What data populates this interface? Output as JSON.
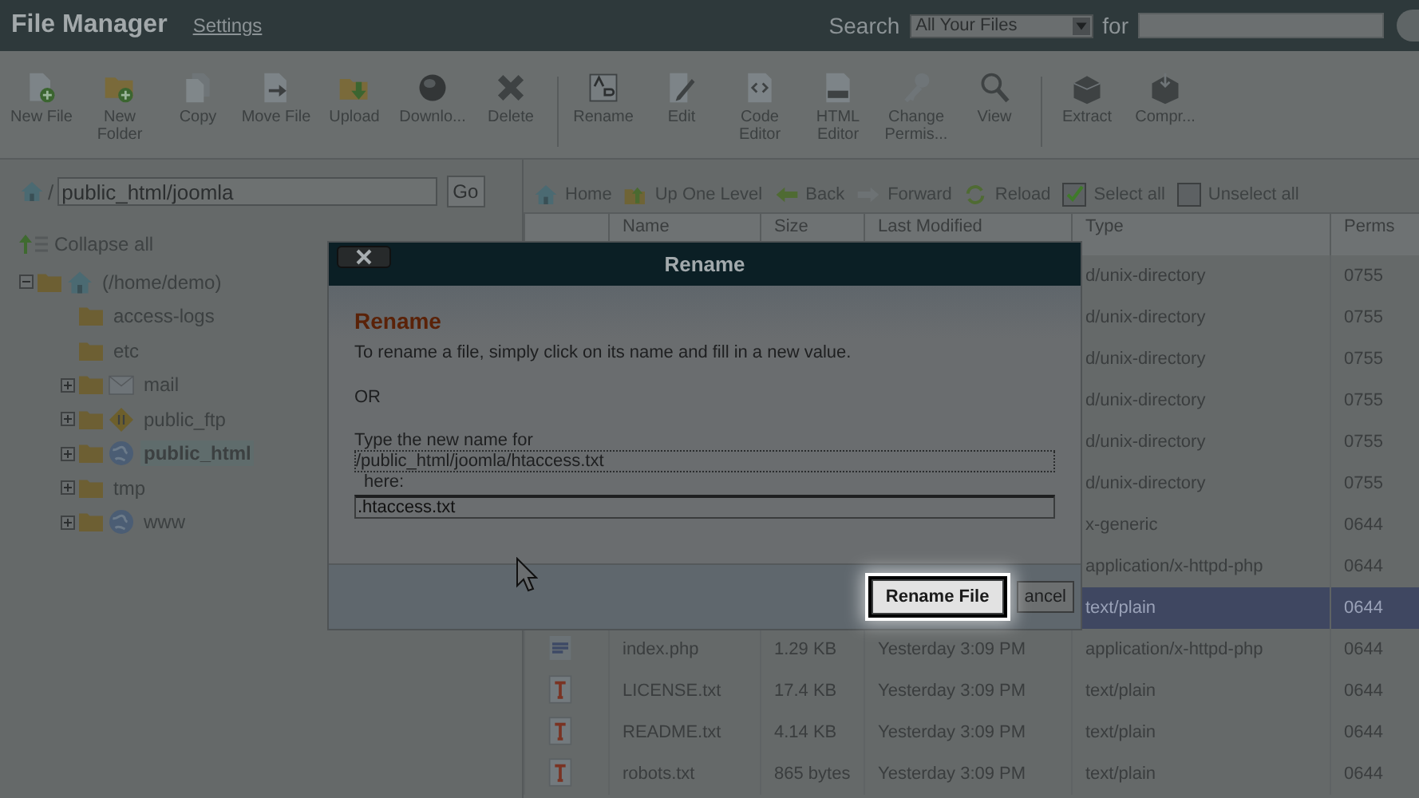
{
  "header": {
    "title": "File Manager",
    "settings_link": "Settings",
    "search_label": "Search",
    "search_scope": "All Your Files",
    "for_label": "for"
  },
  "toolbar": {
    "groups": [
      [
        {
          "label": "New File"
        },
        {
          "label": "New Folder"
        },
        {
          "label": "Copy"
        },
        {
          "label": "Move File"
        },
        {
          "label": "Upload"
        },
        {
          "label": "Downlo..."
        },
        {
          "label": "Delete"
        }
      ],
      [
        {
          "label": "Rename"
        },
        {
          "label": "Edit"
        },
        {
          "label": "Code Editor"
        },
        {
          "label": "HTML Editor"
        },
        {
          "label": "Change Permis..."
        },
        {
          "label": "View"
        }
      ],
      [
        {
          "label": "Extract"
        },
        {
          "label": "Compr..."
        }
      ]
    ]
  },
  "path_bar": {
    "separator": "/",
    "value": "public_html/joomla",
    "button": "Go"
  },
  "tree": {
    "collapse_all": "Collapse all",
    "items": [
      {
        "label": "(/home/demo)",
        "kind": "home",
        "expanded": true,
        "selected": false,
        "children": [
          {
            "label": "access-logs",
            "kind": "folder",
            "selected": false
          },
          {
            "label": "etc",
            "kind": "folder",
            "selected": false
          },
          {
            "label": "mail",
            "kind": "mail",
            "expanded": false,
            "selected": false
          },
          {
            "label": "public_ftp",
            "kind": "ftp",
            "expanded": false,
            "selected": false
          },
          {
            "label": "public_html",
            "kind": "web",
            "expanded": false,
            "selected": true
          },
          {
            "label": "tmp",
            "kind": "folder",
            "expanded": false,
            "selected": false
          },
          {
            "label": "www",
            "kind": "web",
            "expanded": false,
            "selected": false
          }
        ]
      }
    ]
  },
  "nav": [
    {
      "kind": "link",
      "label": "Home"
    },
    {
      "kind": "link",
      "label": "Up One Level"
    },
    {
      "kind": "link",
      "label": "Back"
    },
    {
      "kind": "link",
      "label": "Forward"
    },
    {
      "kind": "link",
      "label": "Reload"
    },
    {
      "kind": "checkbox",
      "label": "Select all",
      "checked": true
    },
    {
      "kind": "checkbox",
      "label": "Unselect all",
      "checked": false
    }
  ],
  "table": {
    "columns": [
      "Name",
      "Size",
      "Last Modified",
      "Type",
      "Perms"
    ],
    "rows": [
      {
        "type": "d/unix-directory",
        "perms": "0755",
        "selected": false
      },
      {
        "type": "d/unix-directory",
        "perms": "0755",
        "selected": false
      },
      {
        "type": "d/unix-directory",
        "perms": "0755",
        "selected": false
      },
      {
        "type": "d/unix-directory",
        "perms": "0755",
        "selected": false
      },
      {
        "type": "d/unix-directory",
        "perms": "0755",
        "selected": false
      },
      {
        "type": "d/unix-directory",
        "perms": "0755",
        "selected": false
      },
      {
        "type": "x-generic",
        "perms": "0644",
        "selected": false
      },
      {
        "type": "application/x-httpd-php",
        "perms": "0644",
        "selected": false
      },
      {
        "type": "text/plain",
        "perms": "0644",
        "selected": true
      },
      {
        "kind": "php",
        "name": "index.php",
        "size": "1.29 KB",
        "modified": "Yesterday 3:09 PM",
        "type": "application/x-httpd-php",
        "perms": "0644",
        "selected": false
      },
      {
        "kind": "text",
        "name": "LICENSE.txt",
        "size": "17.4 KB",
        "modified": "Yesterday 3:09 PM",
        "type": "text/plain",
        "perms": "0644",
        "selected": false
      },
      {
        "kind": "text",
        "name": "README.txt",
        "size": "4.14 KB",
        "modified": "Yesterday 3:09 PM",
        "type": "text/plain",
        "perms": "0644",
        "selected": false
      },
      {
        "kind": "text",
        "name": "robots.txt",
        "size": "865 bytes",
        "modified": "Yesterday 3:09 PM",
        "type": "text/plain",
        "perms": "0644",
        "selected": false
      }
    ]
  },
  "dialog": {
    "title": "Rename",
    "heading": "Rename",
    "instruction": "To rename a file, simply click on its name and fill in a new value.",
    "or_text": "OR",
    "prompt": "Type the new name for",
    "current_path": "/public_html/joomla/htaccess.txt",
    "here_label": "here:",
    "new_name": ".htaccess.txt",
    "buttons": [
      {
        "label": "Rename File",
        "highlighted": true
      },
      {
        "label": "ancel",
        "highlighted": false
      }
    ]
  }
}
